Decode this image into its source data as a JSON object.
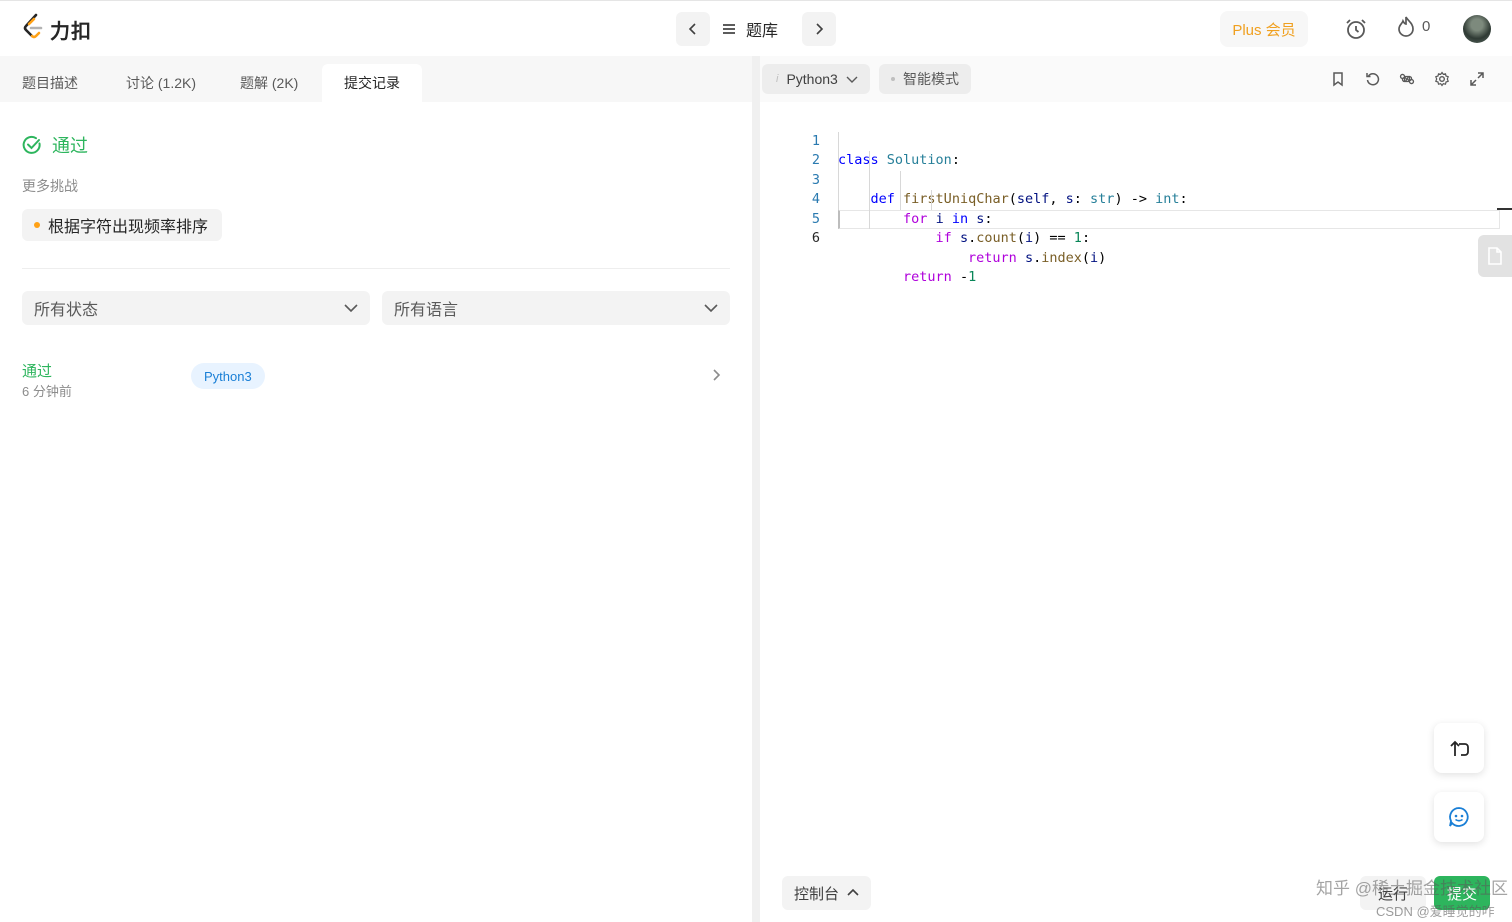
{
  "header": {
    "logo_text": "力扣",
    "problem_bank_label": "题库",
    "plus_label": "Plus 会员",
    "streak_count": "0"
  },
  "left": {
    "tabs": [
      {
        "label": "题目描述"
      },
      {
        "label": "讨论 (1.2K)"
      },
      {
        "label": "题解 (2K)"
      },
      {
        "label": "提交记录"
      }
    ],
    "result_status": "通过",
    "more_challenges_label": "更多挑战",
    "challenge_chip": "根据字符出现频率排序",
    "filters": {
      "status_select": "所有状态",
      "language_select": "所有语言"
    },
    "submissions": [
      {
        "status": "通过",
        "time": "6 分钟前",
        "language": "Python3"
      }
    ]
  },
  "editor": {
    "language": "Python3",
    "mode": "智能模式",
    "code_lines": [
      "class Solution:",
      "    def firstUniqChar(self, s: str) -> int:",
      "        for i in s:",
      "            if s.count(i) == 1:",
      "                return s.index(i)",
      "        return -1"
    ],
    "line_numbers": [
      "1",
      "2",
      "3",
      "4",
      "5",
      "6"
    ],
    "console_label": "控制台",
    "run_label": "运行",
    "submit_label": "提交",
    "watermark_main": "知乎 @稀土掘金技术社区",
    "watermark_sub": "CSDN @爱睡觉的咋"
  },
  "colors": {
    "accent_green": "#2db55d",
    "plus_orange": "#f0a020",
    "badge_blue": "#1a7fd6",
    "chip_dot": "#ffa116"
  },
  "icons": [
    "leetcode-logo-icon",
    "chevron-left-icon",
    "list-icon",
    "chevron-right-icon",
    "alarm-clock-icon",
    "flame-icon",
    "check-circle-icon",
    "chevron-down-icon",
    "bookmark-icon",
    "reset-icon",
    "command-icon",
    "gear-icon",
    "expand-icon",
    "document-icon",
    "swap-icon",
    "chat-bot-icon",
    "chevron-up-icon"
  ]
}
